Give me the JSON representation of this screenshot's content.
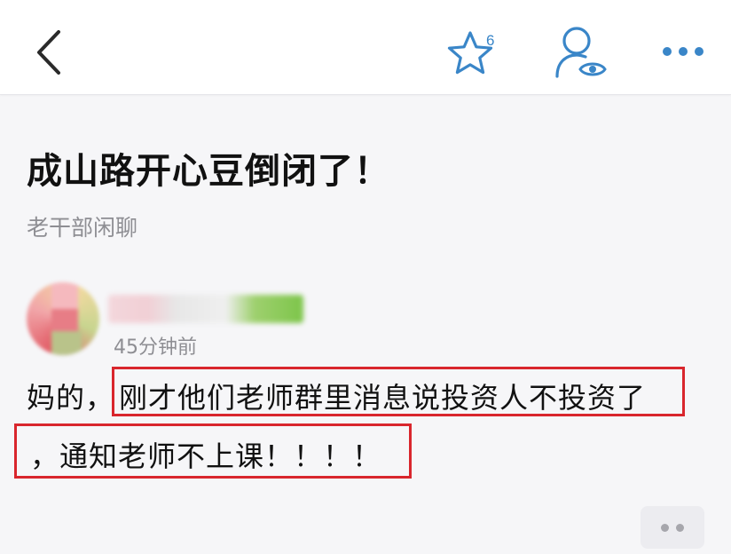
{
  "header": {
    "back_icon": "chevron-left-icon",
    "favorite_icon": "star-outline-icon",
    "favorite_count": "6",
    "profile_icon": "user-eye-icon",
    "more_icon": "more-horizontal-icon",
    "accent_color": "#3a86c8"
  },
  "post": {
    "title": "成山路开心豆倒闭了！",
    "category": "老干部闲聊",
    "author": {
      "avatar_icon": "blurred-avatar",
      "name_blurred": true,
      "timestamp": "45分钟前"
    },
    "body": {
      "line1_prefix": "妈的，",
      "line1_highlight": "刚才他们老师群里消息说投资人不投资了",
      "line2_highlight": "，通知老师不上课！！！！"
    },
    "highlight_color": "#d9262d"
  },
  "footer": {
    "reply_icon": "more-dots-icon"
  }
}
